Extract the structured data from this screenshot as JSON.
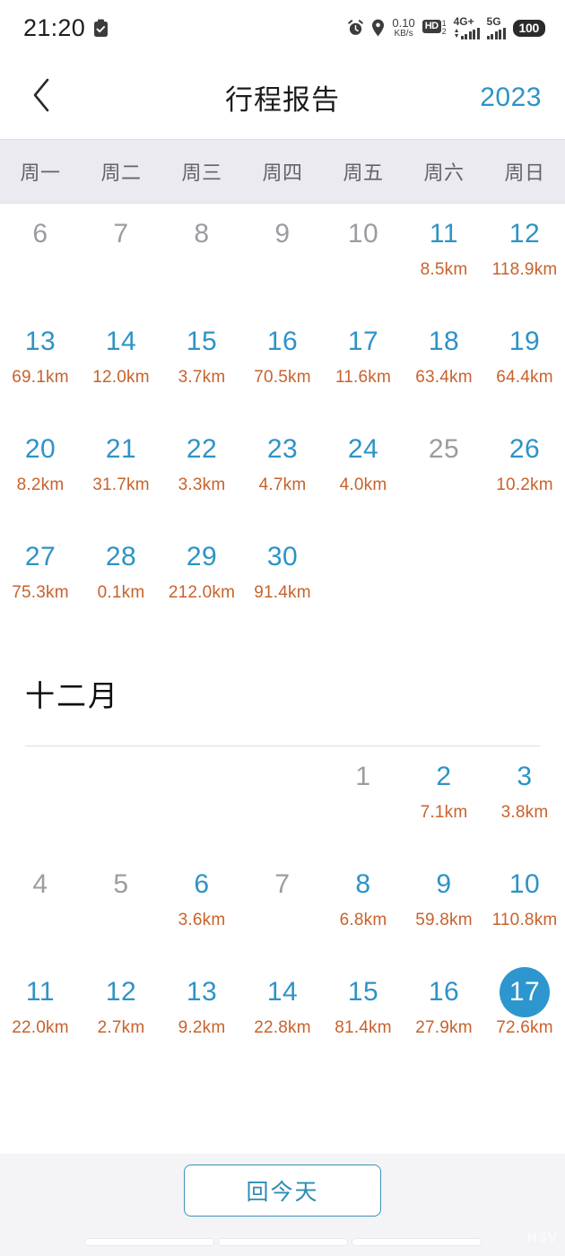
{
  "status_bar": {
    "time": "21:20",
    "clipboard_icon": "clipboard-icon",
    "alarm_icon": "alarm-clock-icon",
    "location_icon": "location-pin-icon",
    "net_speed_value": "0.10",
    "net_speed_unit": "KB/s",
    "hd_label": "HD",
    "hd_sim_top": "1",
    "hd_sim_bottom": "2",
    "sim1_network": "4G+",
    "sim2_network": "5G",
    "battery_level": "100"
  },
  "app_bar": {
    "back_icon": "chevron-left-icon",
    "title": "行程报告",
    "year": "2023"
  },
  "weekdays": [
    "周一",
    "周二",
    "周三",
    "周四",
    "周五",
    "周六",
    "周日"
  ],
  "colors": {
    "accent_blue": "#2d93c6",
    "today_circle": "#2e96ce",
    "distance_orange": "#c8622c",
    "inactive_gray": "#9c9ca1",
    "weekday_header_bg": "#eceaf1",
    "bottom_bar_bg": "#f4f4f7"
  },
  "months": [
    {
      "name": "",
      "show_title": false,
      "weeks": [
        [
          {
            "day": "6",
            "distance": "",
            "state": "inactive"
          },
          {
            "day": "7",
            "distance": "",
            "state": "inactive"
          },
          {
            "day": "8",
            "distance": "",
            "state": "inactive"
          },
          {
            "day": "9",
            "distance": "",
            "state": "inactive"
          },
          {
            "day": "10",
            "distance": "",
            "state": "inactive"
          },
          {
            "day": "11",
            "distance": "8.5km",
            "state": "active"
          },
          {
            "day": "12",
            "distance": "118.9km",
            "state": "active"
          }
        ],
        [
          {
            "day": "13",
            "distance": "69.1km",
            "state": "active"
          },
          {
            "day": "14",
            "distance": "12.0km",
            "state": "active"
          },
          {
            "day": "15",
            "distance": "3.7km",
            "state": "active"
          },
          {
            "day": "16",
            "distance": "70.5km",
            "state": "active"
          },
          {
            "day": "17",
            "distance": "11.6km",
            "state": "active"
          },
          {
            "day": "18",
            "distance": "63.4km",
            "state": "active"
          },
          {
            "day": "19",
            "distance": "64.4km",
            "state": "active"
          }
        ],
        [
          {
            "day": "20",
            "distance": "8.2km",
            "state": "active"
          },
          {
            "day": "21",
            "distance": "31.7km",
            "state": "active"
          },
          {
            "day": "22",
            "distance": "3.3km",
            "state": "active"
          },
          {
            "day": "23",
            "distance": "4.7km",
            "state": "active"
          },
          {
            "day": "24",
            "distance": "4.0km",
            "state": "active"
          },
          {
            "day": "25",
            "distance": "",
            "state": "inactive"
          },
          {
            "day": "26",
            "distance": "10.2km",
            "state": "active"
          }
        ],
        [
          {
            "day": "27",
            "distance": "75.3km",
            "state": "active"
          },
          {
            "day": "28",
            "distance": "0.1km",
            "state": "active"
          },
          {
            "day": "29",
            "distance": "212.0km",
            "state": "active"
          },
          {
            "day": "30",
            "distance": "91.4km",
            "state": "active"
          },
          {
            "day": "",
            "distance": "",
            "state": "empty"
          },
          {
            "day": "",
            "distance": "",
            "state": "empty"
          },
          {
            "day": "",
            "distance": "",
            "state": "empty"
          }
        ]
      ]
    },
    {
      "name": "十二月",
      "show_title": true,
      "weeks": [
        [
          {
            "day": "",
            "distance": "",
            "state": "empty"
          },
          {
            "day": "",
            "distance": "",
            "state": "empty"
          },
          {
            "day": "",
            "distance": "",
            "state": "empty"
          },
          {
            "day": "",
            "distance": "",
            "state": "empty"
          },
          {
            "day": "1",
            "distance": "",
            "state": "inactive"
          },
          {
            "day": "2",
            "distance": "7.1km",
            "state": "active"
          },
          {
            "day": "3",
            "distance": "3.8km",
            "state": "active"
          }
        ],
        [
          {
            "day": "4",
            "distance": "",
            "state": "inactive"
          },
          {
            "day": "5",
            "distance": "",
            "state": "inactive"
          },
          {
            "day": "6",
            "distance": "3.6km",
            "state": "active"
          },
          {
            "day": "7",
            "distance": "",
            "state": "inactive"
          },
          {
            "day": "8",
            "distance": "6.8km",
            "state": "active"
          },
          {
            "day": "9",
            "distance": "59.8km",
            "state": "active"
          },
          {
            "day": "10",
            "distance": "110.8km",
            "state": "active"
          }
        ],
        [
          {
            "day": "11",
            "distance": "22.0km",
            "state": "active"
          },
          {
            "day": "12",
            "distance": "2.7km",
            "state": "active"
          },
          {
            "day": "13",
            "distance": "9.2km",
            "state": "active"
          },
          {
            "day": "14",
            "distance": "22.8km",
            "state": "active"
          },
          {
            "day": "15",
            "distance": "81.4km",
            "state": "active"
          },
          {
            "day": "16",
            "distance": "27.9km",
            "state": "active"
          },
          {
            "day": "17",
            "distance": "72.6km",
            "state": "today"
          }
        ]
      ]
    }
  ],
  "bottom": {
    "today_button_label": "回今天"
  },
  "nav_bar": {
    "watermark": "HSV"
  }
}
